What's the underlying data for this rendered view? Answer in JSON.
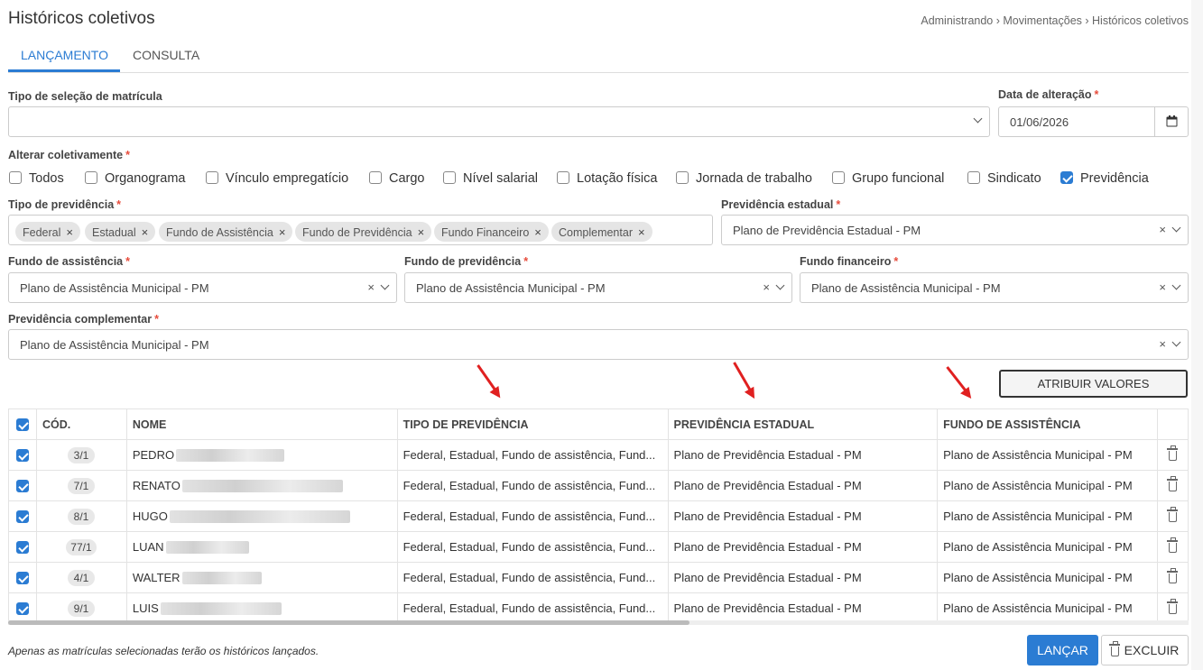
{
  "header": {
    "title": "Históricos coletivos",
    "breadcrumb": "Administrando › Movimentações › Históricos coletivos"
  },
  "tabs": [
    {
      "label": "LANÇAMENTO",
      "active": true
    },
    {
      "label": "CONSULTA",
      "active": false
    }
  ],
  "form": {
    "tipo_selecao": {
      "label": "Tipo de seleção de matrícula",
      "value": ""
    },
    "data_alteracao": {
      "label": "Data de alteração",
      "value": "01/06/2026"
    },
    "alterar": {
      "label": "Alterar coletivamente",
      "options": [
        {
          "label": "Todos",
          "checked": false
        },
        {
          "label": "Organograma",
          "checked": false
        },
        {
          "label": "Vínculo empregatício",
          "checked": false
        },
        {
          "label": "Cargo",
          "checked": false
        },
        {
          "label": "Nível salarial",
          "checked": false
        },
        {
          "label": "Lotação física",
          "checked": false
        },
        {
          "label": "Jornada de trabalho",
          "checked": false
        },
        {
          "label": "Grupo funcional",
          "checked": false
        },
        {
          "label": "Sindicato",
          "checked": false
        },
        {
          "label": "Previdência",
          "checked": true
        }
      ]
    },
    "tipo_previdencia": {
      "label": "Tipo de previdência",
      "tags": [
        "Federal",
        "Estadual",
        "Fundo de Assistência",
        "Fundo de Previdência",
        "Fundo Financeiro",
        "Complementar"
      ]
    },
    "previdencia_estadual": {
      "label": "Previdência estadual",
      "value": "Plano de Previdência Estadual - PM"
    },
    "fundo_assistencia": {
      "label": "Fundo de assistência",
      "value": "Plano de Assistência Municipal - PM"
    },
    "fundo_previdencia": {
      "label": "Fundo de previdência",
      "value": "Plano de Assistência Municipal - PM"
    },
    "fundo_financeiro": {
      "label": "Fundo financeiro",
      "value": "Plano de Assistência Municipal - PM"
    },
    "previdencia_complementar": {
      "label": "Previdência complementar",
      "value": "Plano de Assistência Municipal - PM"
    },
    "required_mark": "*"
  },
  "buttons": {
    "atribuir": "ATRIBUIR VALORES",
    "lancar": "LANÇAR",
    "excluir": "EXCLUIR"
  },
  "table": {
    "headers": [
      "CÓD.",
      "NOME",
      "TIPO DE PREVIDÊNCIA",
      "PREVIDÊNCIA ESTADUAL",
      "FUNDO DE ASSISTÊNCIA"
    ],
    "rows": [
      {
        "code": "3/1",
        "name": "PEDRO",
        "tipo": "Federal, Estadual, Fundo de assistência, Fund...",
        "estadual": "Plano de Previdência Estadual - PM",
        "assistencia": "Plano de Assistência Municipal - PM",
        "checked": true
      },
      {
        "code": "7/1",
        "name": "RENATO",
        "tipo": "Federal, Estadual, Fundo de assistência, Fund...",
        "estadual": "Plano de Previdência Estadual - PM",
        "assistencia": "Plano de Assistência Municipal - PM",
        "checked": true
      },
      {
        "code": "8/1",
        "name": "HUGO",
        "tipo": "Federal, Estadual, Fundo de assistência, Fund...",
        "estadual": "Plano de Previdência Estadual - PM",
        "assistencia": "Plano de Assistência Municipal - PM",
        "checked": true
      },
      {
        "code": "77/1",
        "name": "LUAN",
        "tipo": "Federal, Estadual, Fundo de assistência, Fund...",
        "estadual": "Plano de Previdência Estadual - PM",
        "assistencia": "Plano de Assistência Municipal - PM",
        "checked": true
      },
      {
        "code": "4/1",
        "name": "WALTER",
        "tipo": "Federal, Estadual, Fundo de assistência, Fund...",
        "estadual": "Plano de Previdência Estadual - PM",
        "assistencia": "Plano de Assistência Municipal - PM",
        "checked": true
      },
      {
        "code": "9/1",
        "name": "LUIS",
        "tipo": "Federal, Estadual, Fundo de assistência, Fund...",
        "estadual": "Plano de Previdência Estadual - PM",
        "assistencia": "Plano de Assistência Municipal - PM",
        "checked": true
      }
    ]
  },
  "footnote": "Apenas as matrículas selecionadas terão os históricos lançados.",
  "colors": {
    "accent": "#2b7cd3",
    "required": "#e74c3c",
    "arrow": "#e02020"
  },
  "icons": {
    "calendar": "calendar-icon",
    "trash": "trash-icon",
    "clear": "clear-icon",
    "chevron": "chevron-down-icon"
  }
}
